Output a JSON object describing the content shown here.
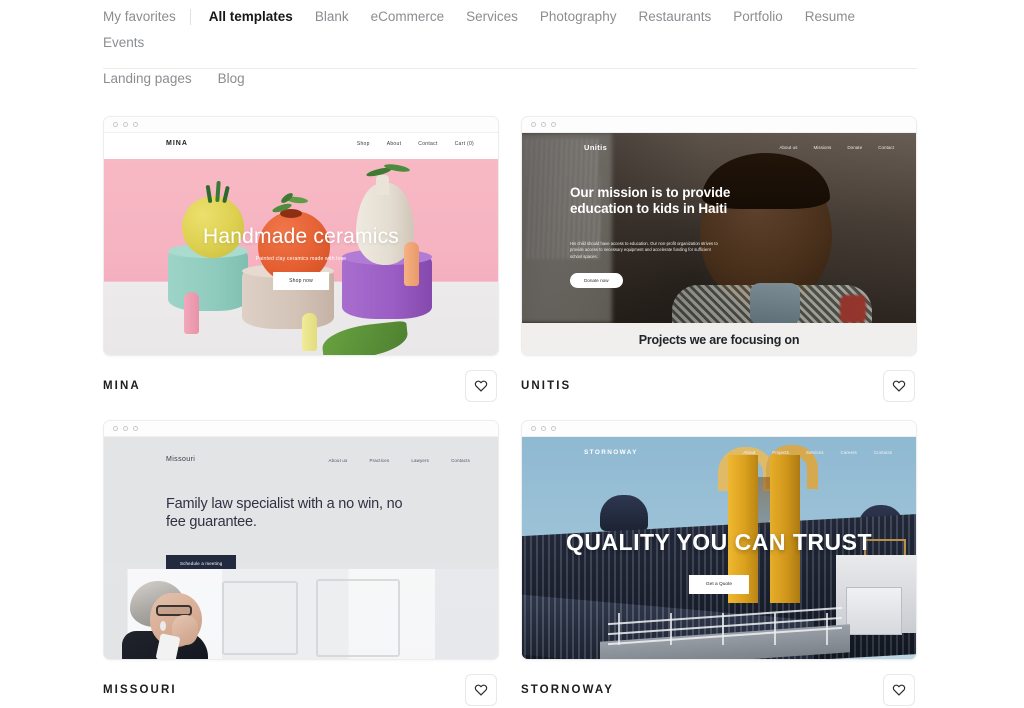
{
  "tabs": {
    "row1": [
      {
        "label": "My favorites",
        "active": false
      },
      {
        "label": "All templates",
        "active": true
      },
      {
        "label": "Blank",
        "active": false
      },
      {
        "label": "eCommerce",
        "active": false
      },
      {
        "label": "Services",
        "active": false
      },
      {
        "label": "Photography",
        "active": false
      },
      {
        "label": "Restaurants",
        "active": false
      },
      {
        "label": "Portfolio",
        "active": false
      },
      {
        "label": "Resume",
        "active": false
      },
      {
        "label": "Events",
        "active": false
      }
    ],
    "row2": [
      {
        "label": "Landing pages",
        "active": false
      },
      {
        "label": "Blog",
        "active": false
      }
    ]
  },
  "favorite_icon": "heart-outline-icon",
  "cards": [
    {
      "name": "MINA",
      "preview": {
        "logo": "MINA",
        "nav": [
          "Shop",
          "About",
          "Contact",
          "Cart (0)"
        ],
        "headline": "Handmade ceramics",
        "subtext": "Painted clay ceramics made with love",
        "button": "Shop now"
      }
    },
    {
      "name": "UNITIS",
      "preview": {
        "logo": "Unitis",
        "nav": [
          "About us",
          "Missions",
          "Donate",
          "Contact"
        ],
        "headline": "Our mission is to provide education to kids in Haiti",
        "subtext": "His child should have access to education. Our non-profit organization strives to provide access to necessary equipment and accelerate funding for sufficient school spaces.",
        "button": "Donate now",
        "section_heading": "Projects we are focusing on"
      }
    },
    {
      "name": "MISSOURI",
      "preview": {
        "logo": "Missouri",
        "nav": [
          "About us",
          "Practices",
          "Lawyers",
          "Contacts"
        ],
        "headline": "Family law specialist with a no win, no fee guarantee.",
        "button": "Schedule a meeting"
      }
    },
    {
      "name": "STORNOWAY",
      "preview": {
        "logo": "STORNOWAY",
        "nav": [
          "About",
          "Projects",
          "Services",
          "Careers",
          "Contacts"
        ],
        "headline": "QUALITY YOU CAN TRUST",
        "button": "Get a Quote"
      }
    }
  ],
  "colors": {
    "active_tab": "#15171a",
    "inactive_tab": "#8a8d91",
    "card_border": "#ededed",
    "missouri_dark": "#232a3f",
    "stornoway_yellow": "#e0a821"
  }
}
